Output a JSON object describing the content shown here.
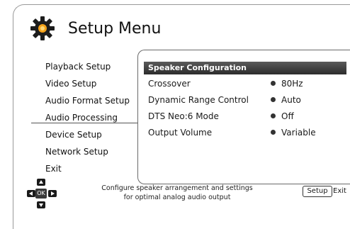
{
  "page_title": "Setup Menu",
  "left_menu": {
    "items": [
      {
        "label": "Playback Setup"
      },
      {
        "label": "Video Setup"
      },
      {
        "label": "Audio Format Setup"
      },
      {
        "label": "Audio Processing"
      },
      {
        "label": "Device Setup"
      },
      {
        "label": "Network Setup"
      },
      {
        "label": "Exit"
      }
    ]
  },
  "panel": {
    "header": "Speaker Configuration",
    "rows": [
      {
        "label": "Crossover",
        "value": "80Hz"
      },
      {
        "label": "Dynamic Range Control",
        "value": "Auto"
      },
      {
        "label": "DTS Neo:6 Mode",
        "value": "Off"
      },
      {
        "label": "Output Volume",
        "value": "Variable"
      }
    ]
  },
  "footer": {
    "hint_line1": "Configure speaker arrangement and settings",
    "hint_line2": "for optimal analog audio output",
    "ok_label": "OK",
    "setup_key": "Setup",
    "exit_label": "Exit"
  }
}
